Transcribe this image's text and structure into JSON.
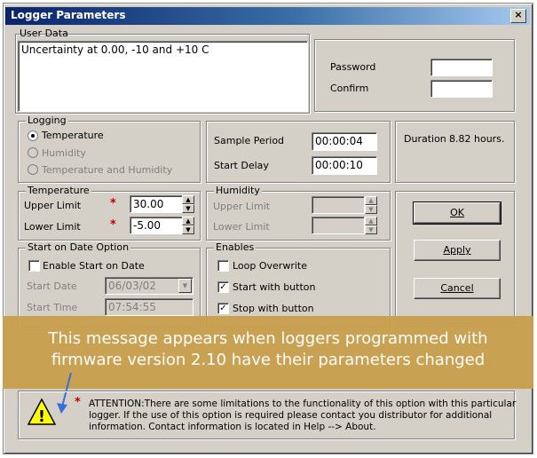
{
  "window": {
    "title": "Logger Parameters",
    "close_label": "×"
  },
  "user_data": {
    "label": "User Data",
    "value": "Uncertainty at 0.00, -10 and +10 C"
  },
  "password": {
    "password_label": "Password",
    "confirm_label": "Confirm",
    "password_value": "",
    "confirm_value": ""
  },
  "logging": {
    "label": "Logging",
    "options": [
      "Temperature",
      "Humidity",
      "Temperature and Humidity"
    ],
    "selected": "Temperature"
  },
  "sampling": {
    "sample_period_label": "Sample Period",
    "sample_period_value": "00:00:04",
    "start_delay_label": "Start Delay",
    "start_delay_value": "00:00:10"
  },
  "duration": {
    "label": "Duration :",
    "value": "8.82 hours."
  },
  "temperature": {
    "label": "Temperature",
    "upper_label": "Upper Limit",
    "upper_value": "30.00",
    "lower_label": "Lower Limit",
    "lower_value": "-5.00",
    "star": "*"
  },
  "humidity": {
    "label": "Humidity",
    "upper_label": "Upper Limit",
    "lower_label": "Lower Limit"
  },
  "start_on_date": {
    "label": "Start on Date Option",
    "enable_label": "Enable Start on Date",
    "enable_checked": false,
    "start_date_label": "Start Date",
    "start_date_value": "06/03/02",
    "start_time_label": "Start Time",
    "start_time_value": "07:54:55"
  },
  "enables": {
    "label": "Enables",
    "loop_overwrite": "Loop Overwrite",
    "start_with_button": "Start with button",
    "stop_with_button": "Stop with button"
  },
  "buttons": {
    "ok": "OK",
    "apply": "Apply",
    "cancel": "Cancel"
  },
  "overlay": {
    "line1": "This message appears when loggers programmed with",
    "line2": "firmware version 2.10 have their parameters changed"
  },
  "attention": {
    "star": "*",
    "line1": "ATTENTION:There are some limitations to the functionality of this option with this particular",
    "line2": "logger.  If the use of this option is required please contact you distributor for additional",
    "line3": "information. Contact information is located in Help --> About."
  },
  "check_mark": "✓",
  "spin_up": "▲",
  "spin_down": "▼",
  "dropdown_arrow": "▼",
  "warning_glyph": "!"
}
